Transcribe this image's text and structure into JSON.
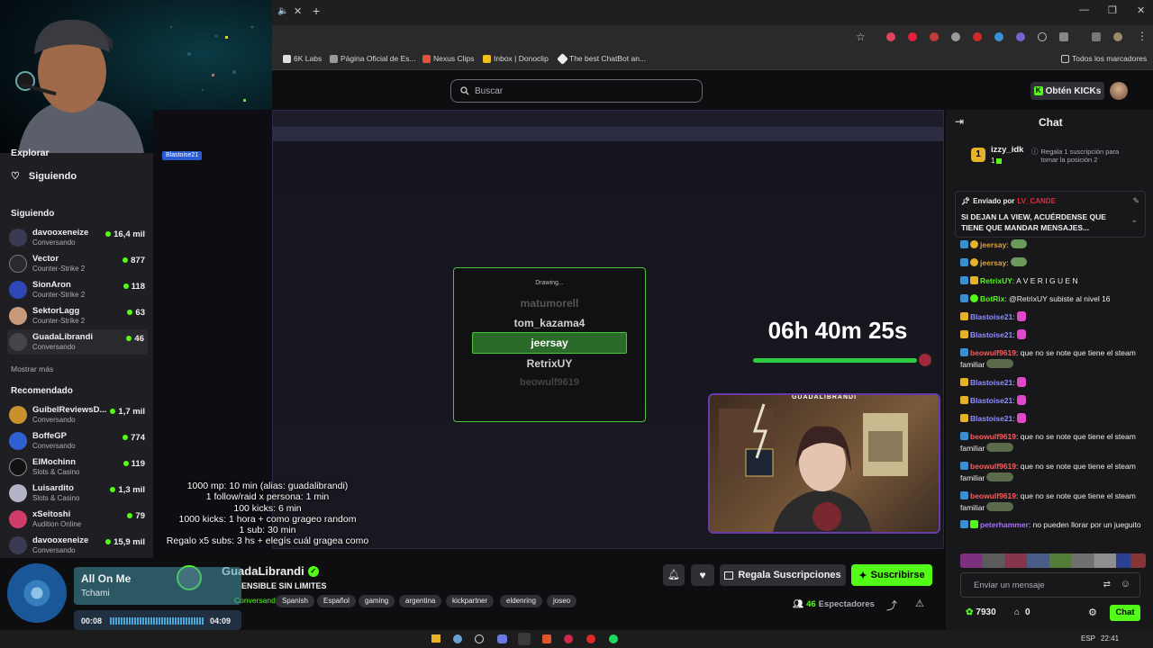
{
  "browser": {
    "bookmarks": [
      "6K Labs",
      "Página Oficial de Es...",
      "Nexus Clips",
      "Inbox | Donoclip",
      "The best ChatBot an..."
    ],
    "all_bookmarks": "Todos los marcadores"
  },
  "topnav": {
    "search_placeholder": "Buscar",
    "kicks_button": "Obtén KICKs"
  },
  "sidebar": {
    "explore": "Explorar",
    "following_link": "Siguiendo",
    "following_header": "Siguiendo",
    "following": [
      {
        "name": "davooxeneize",
        "category": "Conversando",
        "viewers": "16,4 mil"
      },
      {
        "name": "Vector",
        "category": "Counter-Strike 2",
        "viewers": "877"
      },
      {
        "name": "SionAron",
        "category": "Counter-Strike 2",
        "viewers": "118"
      },
      {
        "name": "SektorLagg",
        "category": "Counter-Strike 2",
        "viewers": "63"
      },
      {
        "name": "GuadaLibrandi",
        "category": "Conversando",
        "viewers": "46"
      }
    ],
    "show_more": "Mostrar más",
    "recommended_header": "Recomendado",
    "recommended": [
      {
        "name": "GuibelReviewsD...",
        "category": "Conversando",
        "viewers": "1,7 mil"
      },
      {
        "name": "BoffeGP",
        "category": "Conversando",
        "viewers": "774"
      },
      {
        "name": "ElMochinn",
        "category": "Slots & Casino",
        "viewers": "119"
      },
      {
        "name": "Luisardito",
        "category": "Slots & Casino",
        "viewers": "1,3 mil"
      },
      {
        "name": "xSeitoshi",
        "category": "Audition Online",
        "viewers": "79"
      },
      {
        "name": "davooxeneize",
        "category": "Conversando",
        "viewers": "15,9 mil"
      }
    ]
  },
  "stream": {
    "tag_user": "Blastoise21",
    "raffle": {
      "status": "Drawing...",
      "names": [
        "matumorell",
        "tom_kazama4",
        "jeersay",
        "RetrixUY",
        "beowulf9619"
      ],
      "selected": "jeersay"
    },
    "timer": "06h 40m 25s",
    "cam_label": "GUADALIBRANDI",
    "overlay_lines": [
      "1000 mp: 10 min (alias: guadalibrandi)",
      "1 follow/raid x persona: 1 min",
      "100 kicks: 6 min",
      "1000 kicks: 1 hora + como grageo random",
      "1 sub: 30 min",
      "Regalo x5 subs: 3 hs + elegís cuál gragea como"
    ]
  },
  "channel": {
    "name": "GuadaLibrandi",
    "title": "ENSIBLE SIN LIMITES",
    "category": "Conversando",
    "tags": [
      "Spanish",
      "Español",
      "gaming",
      "argentina",
      "kickpartner",
      "eldenring",
      "joseo"
    ],
    "gift_button": "Regala Suscripciones",
    "subscribe_button": "Suscribirse",
    "viewers": "46",
    "viewers_label": "Espectadores"
  },
  "music": {
    "title": "All On Me",
    "artist": "Tchami",
    "elapsed": "00:08",
    "duration": "04:09",
    "progress": 0.032
  },
  "chat": {
    "title": "Chat",
    "top_gifter": {
      "name": "izzy_idk",
      "count": "1",
      "hint": "Regala 1 suscripción para tomar la posición 2"
    },
    "pinned": {
      "by_label": "Enviado por",
      "by_user": "LV_CANDE",
      "text": "SI DEJAN LA VIEW, ACUÉRDENSE QUE TIENE QUE MANDAR MENSAJES..."
    },
    "messages": [
      {
        "user": "jeersay",
        "text": "",
        "color": "#d9a441"
      },
      {
        "user": "jeersay",
        "text": "",
        "color": "#d9a441"
      },
      {
        "user": "RetrixUY",
        "text": "A V E R I G U E N",
        "color": "#53fc18"
      },
      {
        "user": "BotRix",
        "text": "@RetrixUY subiste al nivel 16",
        "color": "#53fc18"
      },
      {
        "user": "Blastoise21",
        "text": "",
        "color": "#8f8fff"
      },
      {
        "user": "Blastoise21",
        "text": "",
        "color": "#8f8fff"
      },
      {
        "user": "beowulf9619",
        "text": "que no se note que tiene el steam familiar",
        "color": "#ff5a5a"
      },
      {
        "user": "Blastoise21",
        "text": "",
        "color": "#8f8fff"
      },
      {
        "user": "Blastoise21",
        "text": "",
        "color": "#8f8fff"
      },
      {
        "user": "Blastoise21",
        "text": "",
        "color": "#8f8fff"
      },
      {
        "user": "beowulf9619",
        "text": "que no se note que tiene el steam familiar",
        "color": "#ff5a5a"
      },
      {
        "user": "beowulf9619",
        "text": "que no se note que tiene el steam familiar",
        "color": "#ff5a5a"
      },
      {
        "user": "beowulf9619",
        "text": "que no se note que tiene el steam familiar",
        "color": "#ff5a5a"
      },
      {
        "user": "peterhammer",
        "text": "no pueden llorar por un jueguito",
        "color": "#a970ff"
      }
    ],
    "input_placeholder": "Enviar un mensaje",
    "points": "7930",
    "gifts": "0",
    "send_button": "Chat"
  },
  "taskbar": {
    "lang": "ESP",
    "time": "22:41"
  },
  "colors": {
    "kick_green": "#53fc18",
    "bg": "#0e0e10",
    "panel": "#18181b"
  }
}
